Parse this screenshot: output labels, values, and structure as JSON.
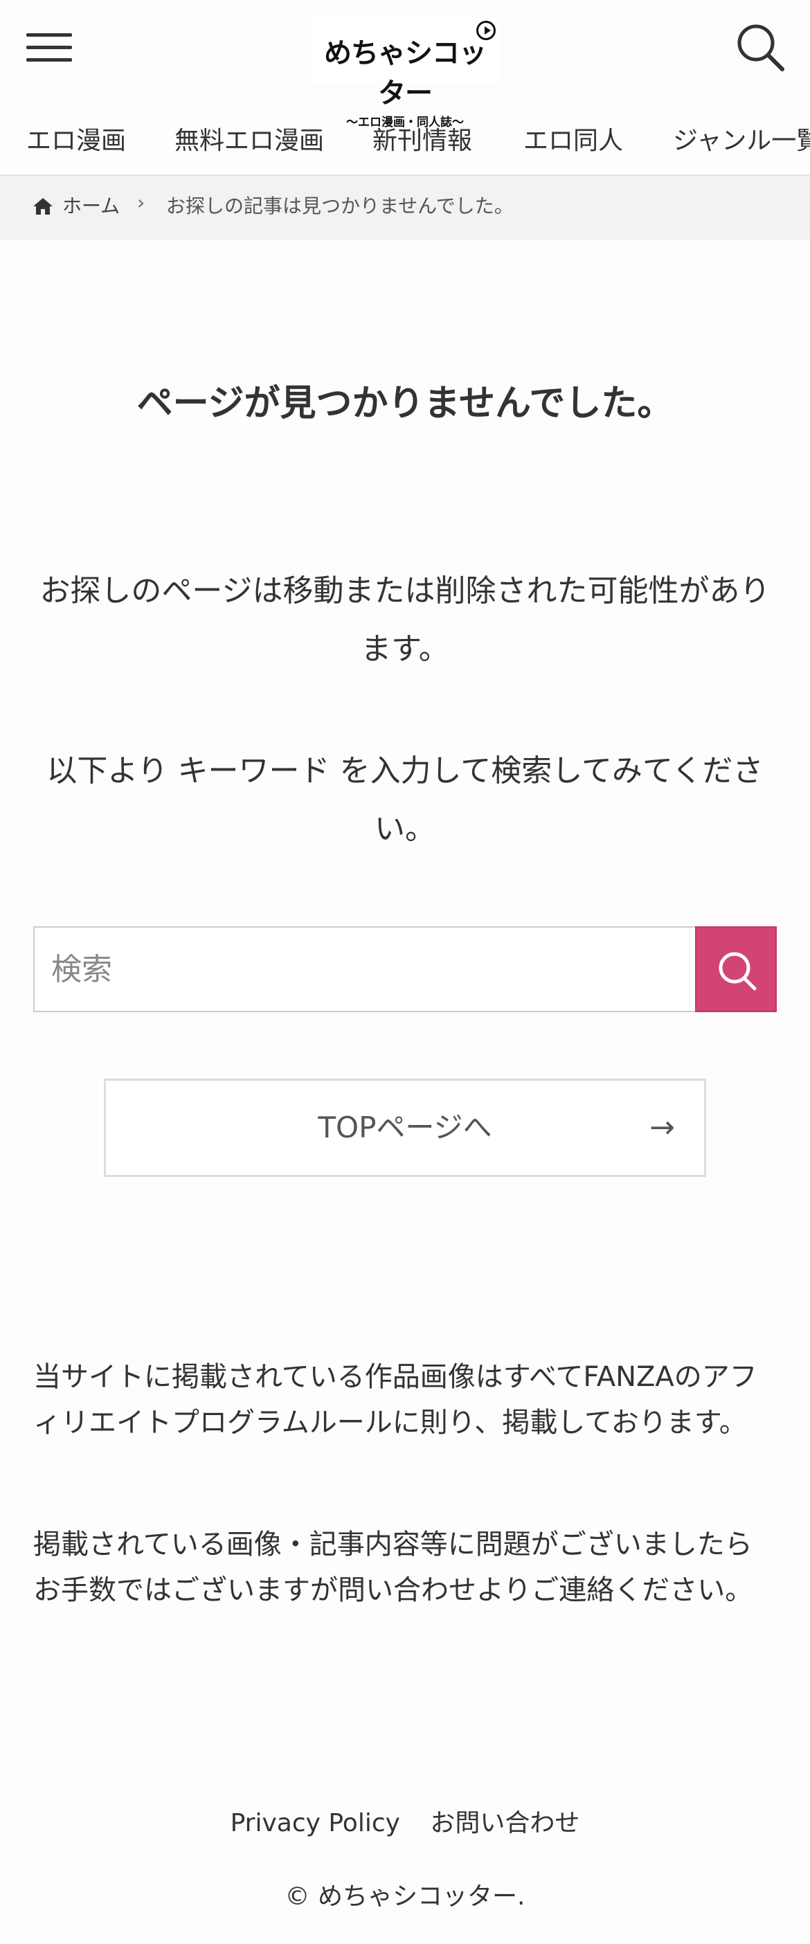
{
  "header": {
    "logo_text": "めちゃシコッター",
    "logo_subtext": "〜エロ漫画・同人誌〜"
  },
  "nav": {
    "items": [
      "エロ漫画",
      "無料エロ漫画",
      "新刊情報",
      "エロ同人",
      "ジャンル一覧"
    ]
  },
  "breadcrumb": {
    "home": "ホーム",
    "separator": "›",
    "current": "お探しの記事は見つかりませんでした。"
  },
  "main": {
    "title": "ページが見つかりませんでした。",
    "message1": "お探しのページは移動または削除された可能性があります。",
    "message2": "以下より キーワード を入力して検索してみてください。",
    "search_placeholder": "検索",
    "top_button_label": "TOPページへ",
    "top_button_arrow": "→"
  },
  "footer": {
    "notice1": "当サイトに掲載されている作品画像はすべてFANZAのアフィリエイトプログラムルールに則り、掲載しております。",
    "notice2": "掲載されている画像・記事内容等に問題がございましたらお手数ではございますが問い合わせよりご連絡ください。",
    "links": [
      "Privacy Policy",
      "お問い合わせ"
    ],
    "copyright": "© めちゃシコッター."
  },
  "colors": {
    "accent": "#d24476",
    "breadcrumb_bg": "#f2f2f2"
  }
}
